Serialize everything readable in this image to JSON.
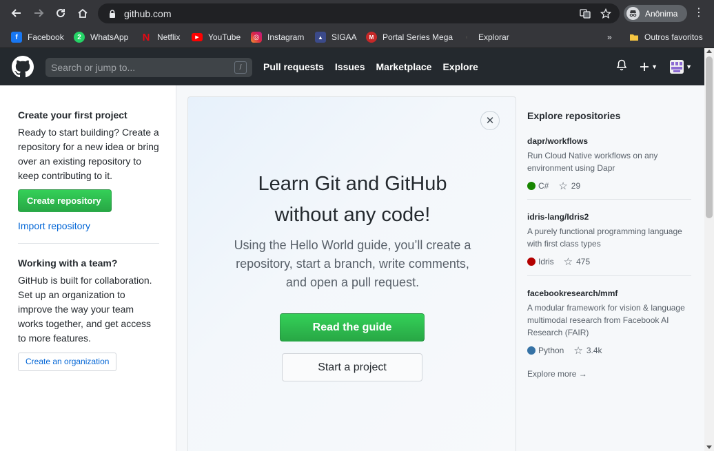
{
  "browser": {
    "url": "github.com",
    "profile_name": "Anônima",
    "bookmarks": [
      {
        "label": "Facebook",
        "icon": "facebook-icon",
        "color": "#1877f2"
      },
      {
        "label": "WhatsApp",
        "icon": "whatsapp-icon",
        "color": "#25d366",
        "badge": "2"
      },
      {
        "label": "Netflix",
        "icon": "netflix-icon",
        "color": "#e50914"
      },
      {
        "label": "YouTube",
        "icon": "youtube-icon",
        "color": "#ff0000"
      },
      {
        "label": "Instagram",
        "icon": "instagram-icon",
        "color": "#d6249f"
      },
      {
        "label": "SIGAA",
        "icon": "sigaa-icon",
        "color": "#3b4a8a"
      },
      {
        "label": "Portal Series Mega",
        "icon": "portal-series-icon",
        "color": "#c62828"
      },
      {
        "label": "Explorar",
        "icon": "explorar-icon",
        "color": "#35363a"
      }
    ],
    "other_bookmarks": "Outros favoritos"
  },
  "header": {
    "search_placeholder": "Search or jump to...",
    "search_key": "/",
    "nav": [
      "Pull requests",
      "Issues",
      "Marketplace",
      "Explore"
    ]
  },
  "left": {
    "create_title": "Create your first project",
    "create_text": "Ready to start building? Create a repository for a new idea or bring over an existing repository to keep contributing to it.",
    "create_button": "Create repository",
    "import_link": "Import repository",
    "team_title": "Working with a team?",
    "team_text": "GitHub is built for collaboration. Set up an organization to improve the way your team works together, and get access to more features.",
    "org_button": "Create an organization"
  },
  "card": {
    "close": "✕",
    "title_line1": "Learn Git and GitHub",
    "title_line2": "without any code!",
    "subtitle": "Using the Hello World guide, you’ll create a repository, start a branch, write comments, and open a pull request.",
    "primary_button": "Read the guide",
    "secondary_button": "Start a project"
  },
  "right": {
    "title": "Explore repositories",
    "repos": [
      {
        "name": "dapr/workflows",
        "description": "Run Cloud Native workflows on any environment using Dapr",
        "language": "C#",
        "lang_color": "#178600",
        "stars": "29"
      },
      {
        "name": "idris-lang/Idris2",
        "description": "A purely functional programming language with first class types",
        "language": "Idris",
        "lang_color": "#b30000",
        "stars": "475"
      },
      {
        "name": "facebookresearch/mmf",
        "description": "A modular framework for vision & language multimodal research from Facebook AI Research (FAIR)",
        "language": "Python",
        "lang_color": "#3572A5",
        "stars": "3.4k"
      }
    ],
    "explore_more": "Explore more →"
  }
}
